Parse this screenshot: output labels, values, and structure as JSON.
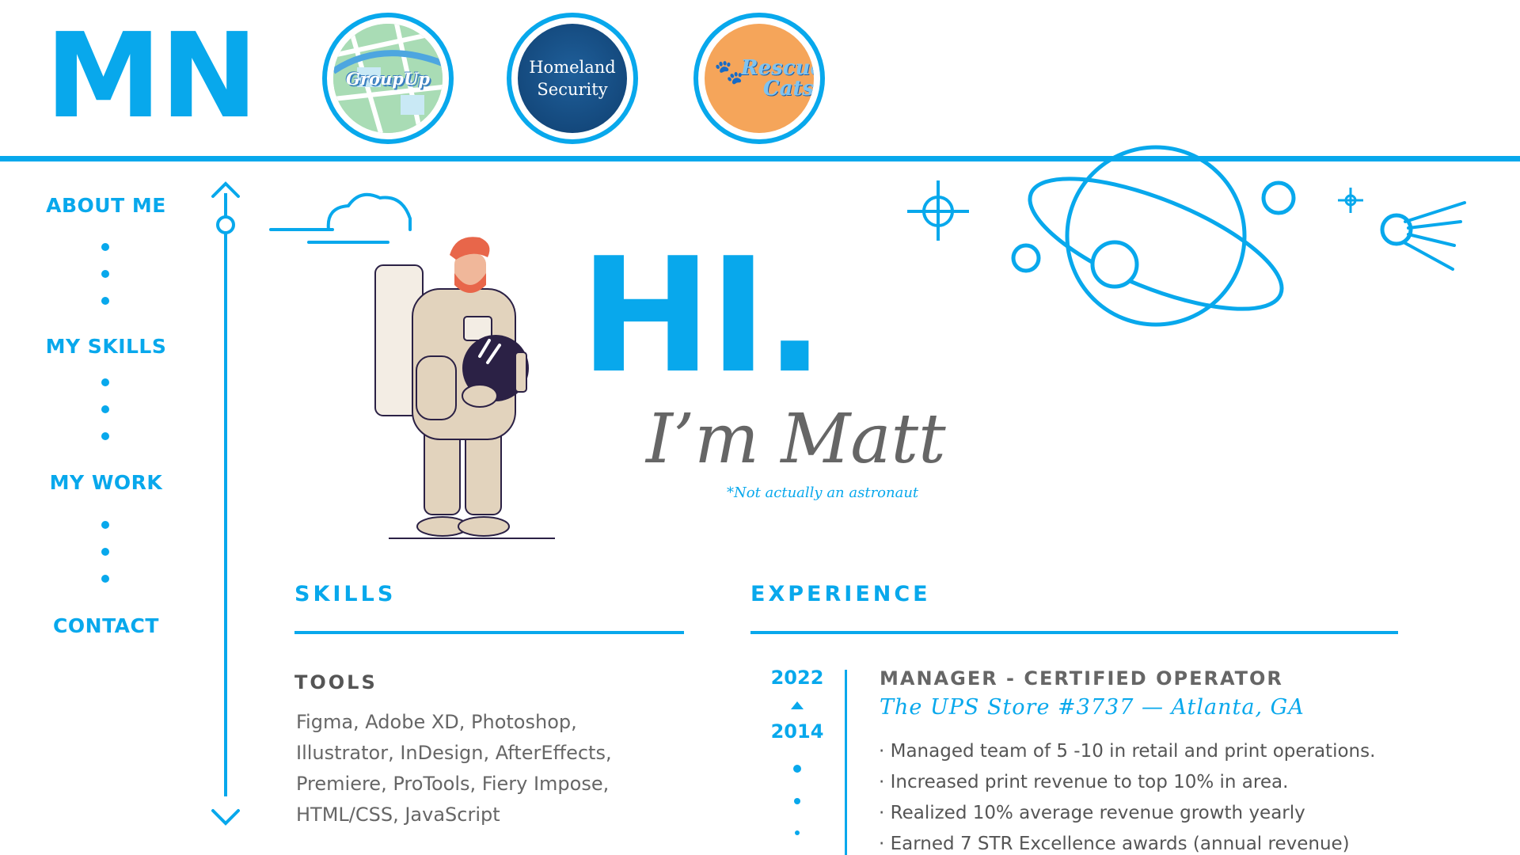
{
  "header": {
    "logo": "MN",
    "badges": [
      {
        "name": "groupup",
        "label": "GroupUp"
      },
      {
        "name": "homeland-security",
        "label_line1": "Homeland",
        "label_line2": "Security"
      },
      {
        "name": "rescue-cats",
        "label_line1": "Rescue",
        "label_line2": "Cats"
      }
    ]
  },
  "nav": {
    "items": [
      "ABOUT ME",
      "MY SKILLS",
      "MY WORK",
      "CONTACT"
    ]
  },
  "hero": {
    "greeting": "HI.",
    "intro": "I’m Matt",
    "footnote": "*Not actually an astronaut"
  },
  "skills": {
    "title": "SKILLS",
    "tools_title": "TOOLS",
    "tools_lines": [
      "Figma, Adobe XD, Photoshop,",
      "Illustrator, InDesign, AfterEffects,",
      "Premiere, ProTools, Fiery Impose,",
      "HTML/CSS, JavaScript"
    ]
  },
  "experience": {
    "title": "EXPERIENCE",
    "year_end": "2022",
    "year_start": "2014",
    "job_title": "MANAGER - CERTIFIED OPERATOR",
    "job_place": "The UPS Store #3737 — Atlanta, GA",
    "bullets": [
      "· Managed team of 5 -10 in retail and print operations.",
      "· Increased print revenue to top 10% in area.",
      "· Realized 10% average revenue growth yearly",
      "· Earned 7 STR Excellence awards (annual revenue)"
    ]
  },
  "colors": {
    "accent": "#08a8ec",
    "text": "#555555"
  }
}
